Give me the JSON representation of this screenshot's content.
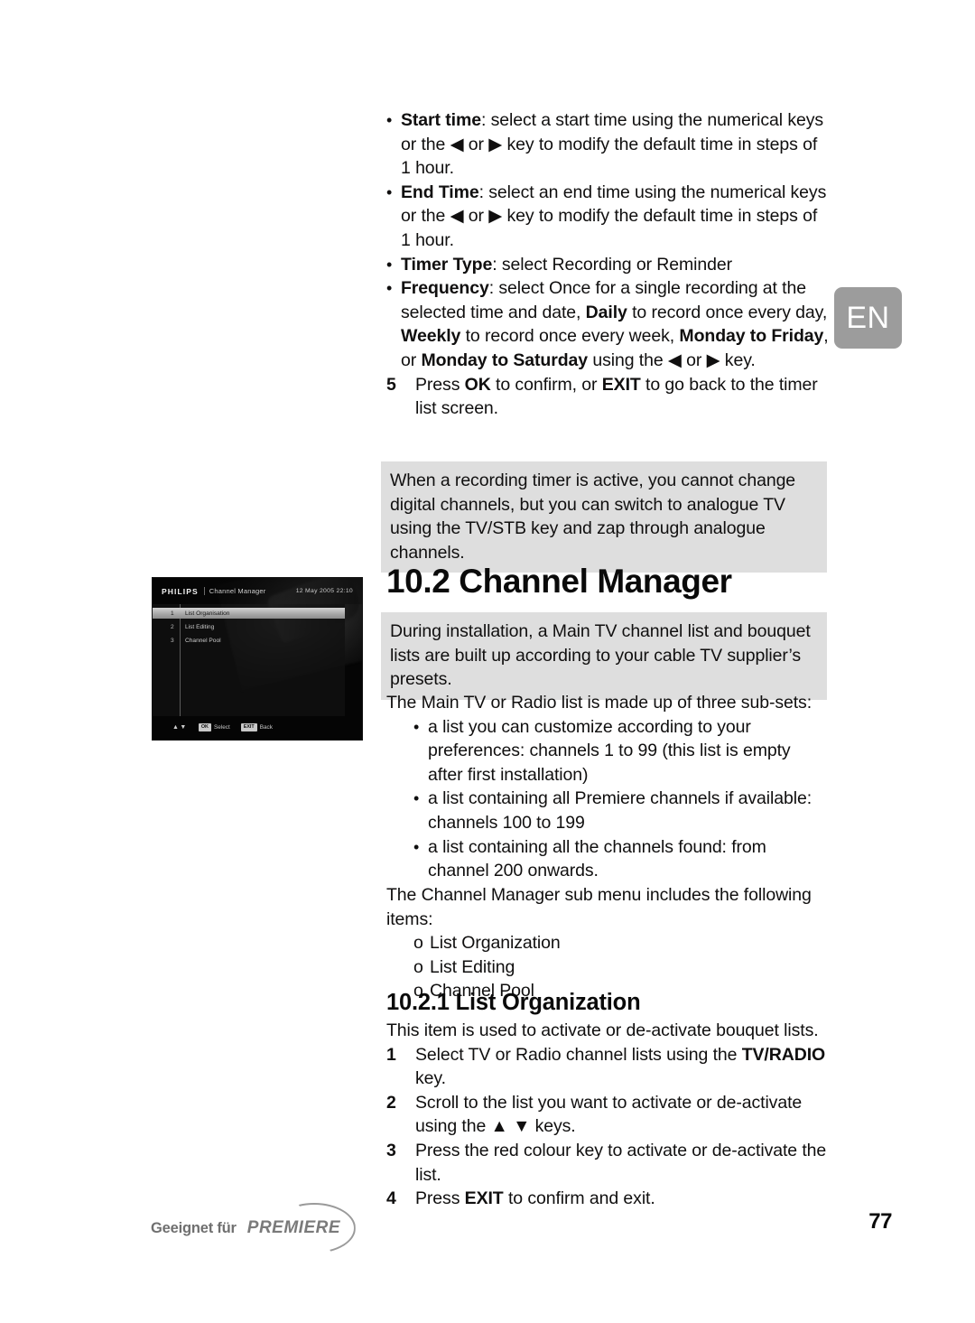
{
  "language_tab": {
    "label": "EN",
    "bg": "#9c9c9c",
    "text_color": "#ffffff"
  },
  "page_number": "77",
  "timer_settings": {
    "bullets": [
      {
        "term": "Start time",
        "text": ": select a start time using the numerical keys or the ◀ or ▶ key to modify the default time in steps of 1 hour."
      },
      {
        "term": "End Time",
        "text": ": select an end time using the numerical keys or the ◀ or ▶ key to modify the default time in steps of 1 hour."
      },
      {
        "term": "Timer Type",
        "text": ": select Recording or Reminder"
      }
    ],
    "frequency": {
      "term": "Frequency",
      "part1": ": select Once for a single recording at the selected time and date, ",
      "bold1": "Daily",
      "part2": " to record once every day, ",
      "bold2": "Weekly",
      "part3": " to record once every week, ",
      "bold3": "Monday to Friday",
      "part4": ", or ",
      "bold4": "Monday to Saturday",
      "part5": " using the ◀ or ▶ key."
    },
    "step5": {
      "num": "5",
      "part1": "Press ",
      "bold1": "OK",
      "part2": " to confirm, or ",
      "bold2": "EXIT",
      "part3": " to go back to the timer list screen."
    }
  },
  "note_box": {
    "text": "When a recording timer is active, you cannot change digital channels, but you can switch to analogue TV using the TV/STB key and zap through analogue channels."
  },
  "channel_manager": {
    "heading": "10.2 Channel Manager",
    "intro_box": "During installation, a Main TV channel list and bouquet lists are built up according to your cable TV supplier’s presets.",
    "subsets_intro": "The Main TV or Radio list is made up of three sub-sets:",
    "subsets": [
      "a list you can customize according to your preferences: channels 1 to 99 (this list is empty after first installation)",
      "a list containing all Premiere channels if available: channels 100 to 199",
      "a list containing all the channels found: from channel 200 onwards."
    ],
    "submenu_intro": "The Channel Manager sub menu includes the following items:",
    "submenu_items": [
      "List Organization",
      "List Editing",
      "Channel Pool"
    ]
  },
  "list_organization": {
    "heading": "10.2.1 List Organization",
    "intro": "This item is used to activate or de-activate bouquet lists.",
    "steps": [
      {
        "num": "1",
        "part1": "Select TV or Radio channel lists using the ",
        "bold1": "TV/RADIO",
        "part2": " key."
      },
      {
        "num": "2",
        "part1": "Scroll to the list you want to activate or de-activate using the ▲ ▼ keys.",
        "bold1": "",
        "part2": ""
      },
      {
        "num": "3",
        "part1": "Press the red colour key to activate or de-activate the list.",
        "bold1": "",
        "part2": ""
      },
      {
        "num": "4",
        "part1": "Press ",
        "bold1": "EXIT",
        "part2": " to confirm and exit."
      }
    ]
  },
  "tv_screenshot": {
    "brand": "PHILIPS",
    "title": "Channel Manager",
    "datetime": "12 May 2005   22:10",
    "menu_items": [
      {
        "index": "1",
        "label": "List Organisation",
        "selected": true
      },
      {
        "index": "2",
        "label": "List Editing",
        "selected": false
      },
      {
        "index": "3",
        "label": "Channel Pool",
        "selected": false
      }
    ],
    "footer": {
      "arrows": "▲▼",
      "ok_key": "OK",
      "ok_label": "Select",
      "exit_key": "EXIT",
      "exit_label": "Back"
    }
  },
  "footer_logo": {
    "prefix": "Geeignet für",
    "brand": "PREMIERE"
  }
}
